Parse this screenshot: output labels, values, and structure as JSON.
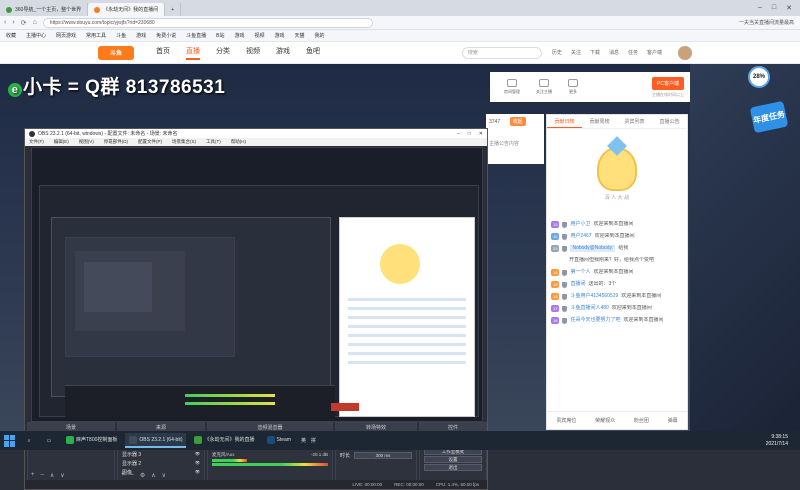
{
  "browser": {
    "tabs": [
      {
        "label": "360导航_一个主页，整个世界",
        "active": false
      },
      {
        "label": "《永劫无间》我的直播间",
        "active": true
      }
    ],
    "new_tab": "+",
    "address": "https://www.douyu.com/topic/yjwjfs?rid=230680",
    "addr_right": "一夫当关直播间流量最高",
    "bookmarks": [
      "收藏",
      "主播中心",
      "网页游戏",
      "常用工具",
      "斗鱼",
      "游戏",
      "免费小说",
      "斗鱼直播",
      "B站",
      "游戏",
      "视频",
      "游戏",
      "天猫",
      "我的"
    ]
  },
  "site": {
    "logo": "斗鱼",
    "nav": [
      "首页",
      "直播",
      "分类",
      "视频",
      "游戏",
      "鱼吧"
    ],
    "active_nav": "直播",
    "search_placeholder": "搜索",
    "header_icons": [
      "历史",
      "关注",
      "下载",
      "消息",
      "任务",
      "客户端"
    ]
  },
  "watermark": {
    "e": "e",
    "text": "小卡 = Q群 813786531"
  },
  "room": {
    "icons": [
      "房间管理",
      "关注主播",
      "更多"
    ],
    "pc_button": "PC客户端",
    "pc_sub": "主播在线时间以上",
    "badge": "28%",
    "event": "年度任务",
    "under_strip_id": "3747",
    "fold_label": "收起",
    "under_strip_text": "主播公告内容"
  },
  "chat": {
    "tabs": [
      "贡献日榜",
      "贡献周榜",
      "贵宾列表",
      "直播公告"
    ],
    "slogan": "百 人 大 战",
    "messages": [
      {
        "lv": "13",
        "lvc": "purple",
        "user": "用户小卫",
        "text": "欢迎来到本直播间",
        "hl": false
      },
      {
        "lv": "12",
        "lvc": "blue",
        "user": "用户2467",
        "text": "欢迎来到本直播间",
        "hl": false
      },
      {
        "lv": "23",
        "lvc": "gray",
        "user": "Nobody@Nobody:",
        "text": "给我",
        "hl": true
      },
      {
        "lv": "",
        "lvc": "",
        "user": "",
        "text": "开直播间但我刚来？好，给我点个赞吧",
        "hl": false
      },
      {
        "lv": "15",
        "lvc": "orange",
        "user": "第一个人",
        "text": "欢迎来到本直播间",
        "hl": false
      },
      {
        "lv": "13",
        "lvc": "orange",
        "user": "直播间",
        "text": "送出的：3个",
        "hl": false
      },
      {
        "lv": "15",
        "lvc": "orange",
        "user": "斗鱼用户4134560529",
        "text": "欢迎来到本直播间",
        "hl": false
      },
      {
        "lv": "17",
        "lvc": "purple",
        "user": "斗鱼直播间人480",
        "text": "欢迎来到本直播间",
        "hl": false
      },
      {
        "lv": "18",
        "lvc": "purple",
        "user": "任哥今天也要努力了吧",
        "text": "欢迎来到本直播间",
        "hl": false
      }
    ],
    "bottom": [
      "贵宾席位",
      "荣耀观众",
      "粉丝团",
      "弹幕"
    ]
  },
  "obs": {
    "title": "OBS 23.2.1 (64-bit, windows) - 配置文件: 未命名 - 场景: 未命名",
    "menu": [
      "文件(F)",
      "编辑(E)",
      "视图(V)",
      "停靠部件(D)",
      "配置文件(P)",
      "场景集合(S)",
      "工具(T)",
      "帮助(H)"
    ],
    "docks": {
      "scenes": {
        "title": "场景",
        "items": [
          "场景"
        ]
      },
      "sources": {
        "title": "来源",
        "items": [
          "图像 3",
          "摄像头",
          "显示器 3",
          "显示器 2",
          "图像"
        ]
      },
      "mixer": {
        "title": "音频混音器",
        "rows": [
          {
            "name": "桌面音频",
            "db": "0.0 dB"
          },
          {
            "name": "麦克风/Aux",
            "db": "-20.1 dB"
          }
        ]
      },
      "transitions": {
        "title": "转场特效",
        "type": "淡出",
        "duration_label": "时长",
        "duration": "300 ms"
      },
      "controls": {
        "title": "控件",
        "buttons": [
          "停止推流",
          "开始录制",
          "工作室模式",
          "设置",
          "退出"
        ]
      }
    },
    "status": [
      "LIVE: 00:00:00",
      "REC: 00:00:00",
      "CPU: 1.4%, 60.00 fps"
    ]
  },
  "taskbar": {
    "items": [
      {
        "label": "麻声T800控制面板",
        "color": "#2ab24a",
        "on": false
      },
      {
        "label": "OBS 23.2.1 (64-bit)",
        "color": "#444a59",
        "on": true
      },
      {
        "label": "《永劫无间》我的直播",
        "color": "#3a9c3a",
        "on": false
      },
      {
        "label": "Steam",
        "color": "#1b4d7a",
        "on": false
      }
    ],
    "time": "9:38:15",
    "date": "2021/7/14",
    "tray": [
      "英",
      "拼"
    ]
  },
  "colors": {
    "accent": "#ff5d23",
    "obs_bg": "#2b2e38"
  }
}
